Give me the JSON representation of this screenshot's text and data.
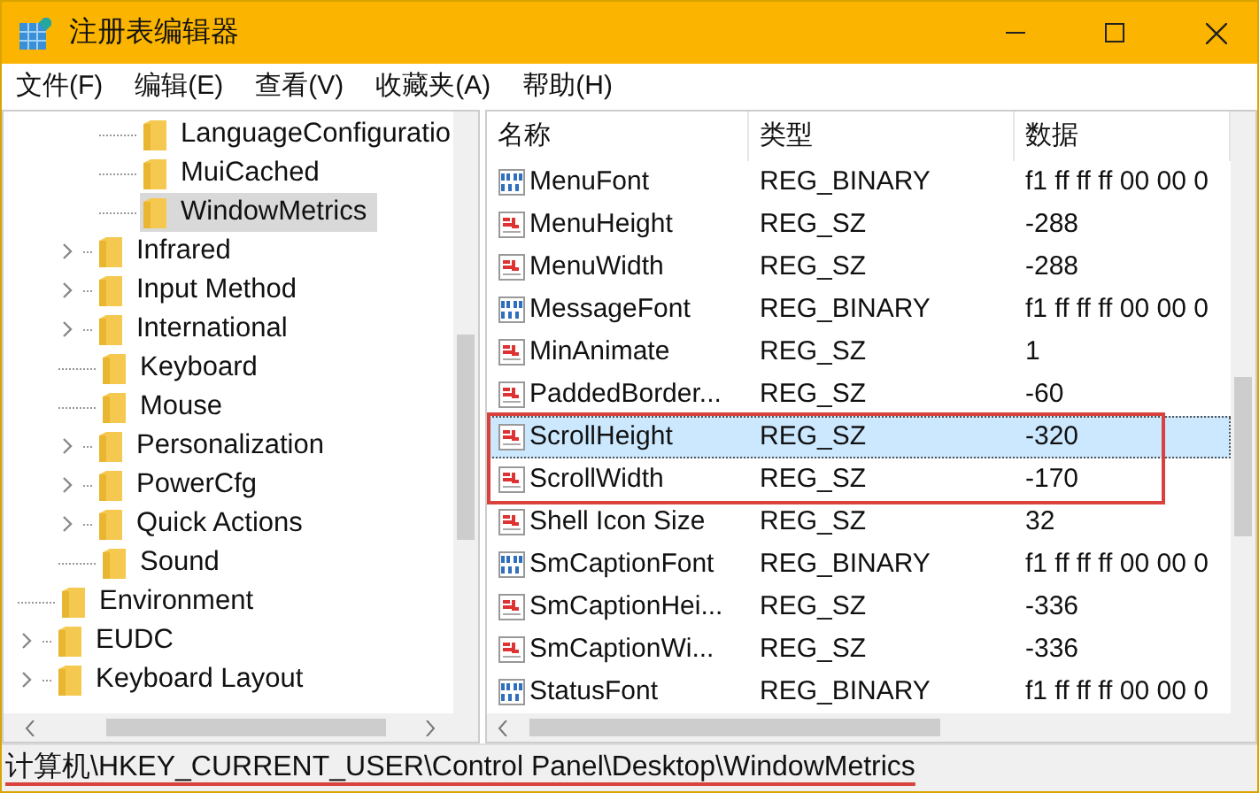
{
  "window": {
    "title": "注册表编辑器"
  },
  "menu": [
    "文件(F)",
    "编辑(E)",
    "查看(V)",
    "收藏夹(A)",
    "帮助(H)"
  ],
  "tree": {
    "items": [
      {
        "children": [
          {
            "children": [
              {
                "label": "LanguageConfiguratio",
                "expandable": false,
                "selected": false
              },
              {
                "label": "MuiCached",
                "expandable": false,
                "selected": false
              },
              {
                "label": "WindowMetrics",
                "expandable": false,
                "selected": true
              }
            ]
          },
          {
            "label": "Infrared",
            "expandable": true,
            "selected": false
          },
          {
            "label": "Input Method",
            "expandable": true,
            "selected": false
          },
          {
            "label": "International",
            "expandable": true,
            "selected": false
          },
          {
            "label": "Keyboard",
            "expandable": false,
            "selected": false
          },
          {
            "label": "Mouse",
            "expandable": false,
            "selected": false
          },
          {
            "label": "Personalization",
            "expandable": true,
            "selected": false
          },
          {
            "label": "PowerCfg",
            "expandable": true,
            "selected": false
          },
          {
            "label": "Quick Actions",
            "expandable": true,
            "selected": false
          },
          {
            "label": "Sound",
            "expandable": false,
            "selected": false
          }
        ]
      },
      {
        "label": "Environment",
        "expandable": false,
        "selected": false
      },
      {
        "label": "EUDC",
        "expandable": true,
        "selected": false
      },
      {
        "label": "Keyboard Layout",
        "expandable": true,
        "selected": false
      }
    ]
  },
  "table": {
    "columns": [
      "名称",
      "类型",
      "数据"
    ],
    "rows": [
      {
        "kind": "binary",
        "name": "MenuFont",
        "type": "REG_BINARY",
        "data": "f1 ff ff ff 00 00 0",
        "selected": false,
        "outlined": false
      },
      {
        "kind": "string",
        "name": "MenuHeight",
        "type": "REG_SZ",
        "data": "-288",
        "selected": false,
        "outlined": false
      },
      {
        "kind": "string",
        "name": "MenuWidth",
        "type": "REG_SZ",
        "data": "-288",
        "selected": false,
        "outlined": false
      },
      {
        "kind": "binary",
        "name": "MessageFont",
        "type": "REG_BINARY",
        "data": "f1 ff ff ff 00 00 0",
        "selected": false,
        "outlined": false
      },
      {
        "kind": "string",
        "name": "MinAnimate",
        "type": "REG_SZ",
        "data": "1",
        "selected": false,
        "outlined": false
      },
      {
        "kind": "string",
        "name": "PaddedBorder...",
        "type": "REG_SZ",
        "data": "-60",
        "selected": false,
        "outlined": false
      },
      {
        "kind": "string",
        "name": "ScrollHeight",
        "type": "REG_SZ",
        "data": "-320",
        "selected": true,
        "outlined": true
      },
      {
        "kind": "string",
        "name": "ScrollWidth",
        "type": "REG_SZ",
        "data": "-170",
        "selected": false,
        "outlined": true
      },
      {
        "kind": "string",
        "name": "Shell Icon Size",
        "type": "REG_SZ",
        "data": "32",
        "selected": false,
        "outlined": false
      },
      {
        "kind": "binary",
        "name": "SmCaptionFont",
        "type": "REG_BINARY",
        "data": "f1 ff ff ff 00 00 0",
        "selected": false,
        "outlined": false
      },
      {
        "kind": "string",
        "name": "SmCaptionHei...",
        "type": "REG_SZ",
        "data": "-336",
        "selected": false,
        "outlined": false
      },
      {
        "kind": "string",
        "name": "SmCaptionWi...",
        "type": "REG_SZ",
        "data": "-336",
        "selected": false,
        "outlined": false
      },
      {
        "kind": "binary",
        "name": "StatusFont",
        "type": "REG_BINARY",
        "data": "f1 ff ff ff 00 00 0",
        "selected": false,
        "outlined": false
      }
    ]
  },
  "status_bar": {
    "path": "计算机\\HKEY_CURRENT_USER\\Control Panel\\Desktop\\WindowMetrics",
    "underlined": true
  }
}
